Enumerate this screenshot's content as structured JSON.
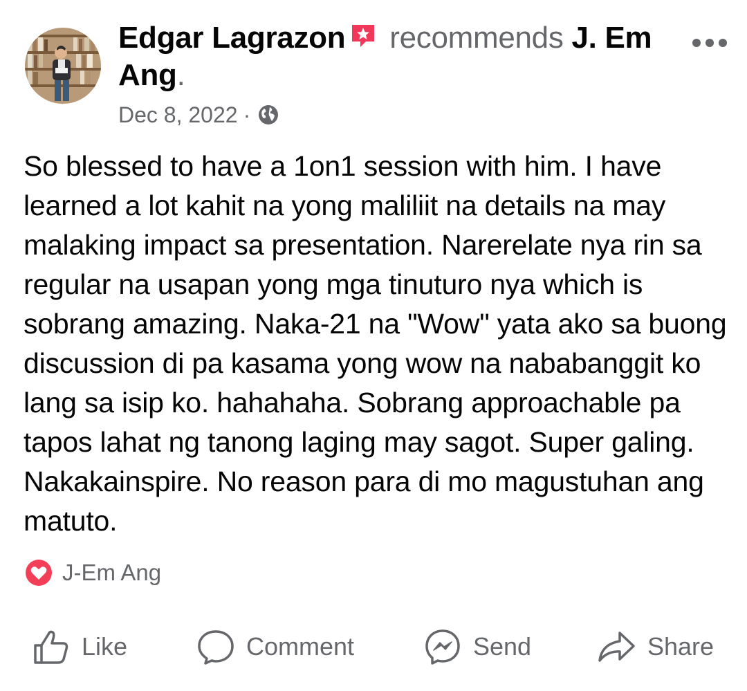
{
  "post": {
    "author": "Edgar Lagrazon",
    "action_text": "recommends",
    "target": "J. Em Ang",
    "target_suffix": ".",
    "date": "Dec 8, 2022",
    "separator": "·",
    "audience_icon": "globe-icon",
    "more_icon": "more-options-icon",
    "badge_icon": "recommendation-badge-icon",
    "text": "So blessed to have a 1on1 session with him. I have learned a lot kahit na yong maliliit na details na may malaking impact sa presentation. Narerelate nya rin sa regular na usapan yong mga tinuturo nya which is sobrang amazing. Naka-21 na \"Wow\" yata ako sa buong discussion di pa kasama yong wow na nababanggit ko lang sa isip ko. hahahaha. Sobrang approachable pa tapos lahat ng tanong laging may sagot. Super galing. Nakakainspire. No reason para di mo magustuhan ang matuto."
  },
  "reactions": {
    "icon": "love-reaction-icon",
    "names": "J-Em Ang"
  },
  "actions": {
    "like": "Like",
    "comment": "Comment",
    "send": "Send",
    "share": "Share"
  },
  "colors": {
    "primary_text": "#050505",
    "secondary_text": "#65676b",
    "badge": "#f2385a",
    "love": "#f33e58"
  }
}
